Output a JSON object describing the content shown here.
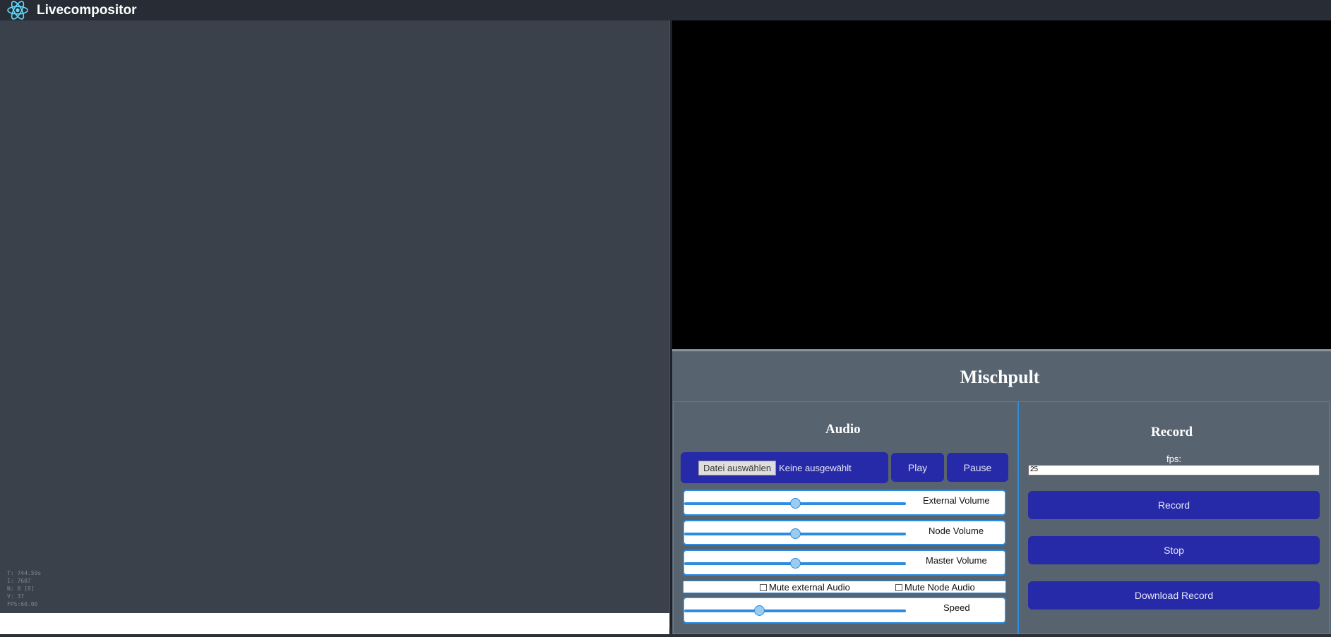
{
  "header": {
    "title": "Livecompositor",
    "logo_icon": "react-atom-icon"
  },
  "stats": {
    "lines": [
      "T: 744.59s",
      "I: 7607",
      "N: 0 [0]",
      "V: 37",
      "FPS:60.00"
    ]
  },
  "mixer": {
    "title": "Mischpult",
    "audio": {
      "title": "Audio",
      "file_button": "Datei auswählen",
      "file_status": "Keine ausgewählt",
      "play_label": "Play",
      "pause_label": "Pause",
      "sliders": [
        {
          "label": "External Volume",
          "value": 0.5
        },
        {
          "label": "Node Volume",
          "value": 0.5
        },
        {
          "label": "Master Volume",
          "value": 0.5
        }
      ],
      "mute_external_label": "Mute external Audio",
      "mute_node_label": "Mute Node Audio",
      "speed": {
        "label": "Speed",
        "value": 0.34
      }
    },
    "record": {
      "title": "Record",
      "fps_label": "fps:",
      "fps_value": "25",
      "record_label": "Record",
      "stop_label": "Stop",
      "download_label": "Download Record"
    }
  },
  "colors": {
    "accent": "#2b8ce0",
    "button": "#2629a8",
    "panel": "#57636f",
    "canvas": "#3a414b"
  }
}
